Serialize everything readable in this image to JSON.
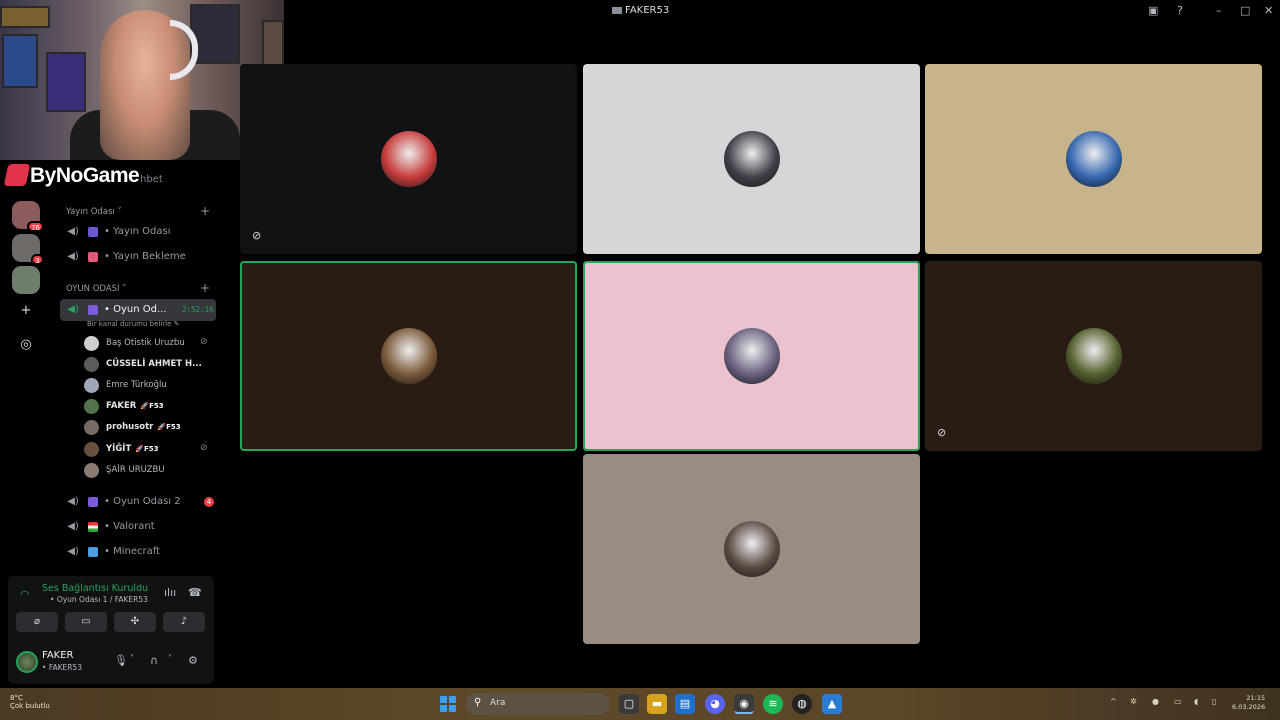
{
  "window": {
    "title": "FAKER53"
  },
  "overlay": {
    "brand": "ByNoGame",
    "brand_tail": "hbet"
  },
  "servers": [
    {
      "badge": "76",
      "color": "#8c5b5b"
    },
    {
      "badge": "3",
      "color": "#6d6a68"
    },
    {
      "badge": "",
      "color": "#6f7d6c"
    }
  ],
  "categories": {
    "yayin": "Yayın Odası",
    "oyun": "OYUN ODASI"
  },
  "channels": {
    "yayin_odasi": "Yayın Odası",
    "yayin_bekleme": "Yayın Bekleme",
    "oyun_odasi": "Oyun Od...",
    "oyun_timer": "2:52:16",
    "oyun_status": "Bir kanal durumu belirle",
    "oyun_odasi_2": "Oyun Odası 2",
    "oyun_odasi_2_badge": "4",
    "valorant": "Valorant",
    "minecraft": "Minecraft"
  },
  "members": [
    {
      "name": "Baş Otistik Uruzbu",
      "tag": "",
      "color": "#cfcfcf",
      "muted": true,
      "bold": false
    },
    {
      "name": "CÜSSELİ AHMET H...",
      "tag": "",
      "color": "#5b5b5b",
      "muted": false,
      "bold": true
    },
    {
      "name": "Emre Türkoğlu",
      "tag": "",
      "color": "#a0a8b8",
      "muted": false,
      "bold": false
    },
    {
      "name": "FAKER",
      "tag": "F53",
      "color": "#52744a",
      "muted": false,
      "bold": true
    },
    {
      "name": "prohusotr",
      "tag": "F53",
      "color": "#7a6a66",
      "muted": false,
      "bold": true
    },
    {
      "name": "YİĞİT",
      "tag": "F53",
      "color": "#6a4f3f",
      "muted": true,
      "bold": true
    },
    {
      "name": "ŞAİR URUZBU",
      "tag": "",
      "color": "#8a7a70",
      "muted": false,
      "bold": false
    }
  ],
  "voice": {
    "status": "Ses Bağlantısı Kuruldu",
    "location": "Oyun Odası 1 / FAKER53"
  },
  "user": {
    "name": "FAKER",
    "sub": "FAKER53"
  },
  "tiles": [
    {
      "bg": "#111214",
      "avatar": "#c73c3c",
      "muted": true,
      "speaking": false
    },
    {
      "bg": "#d5d6d8",
      "avatar": "#40404a",
      "muted": false,
      "speaking": false
    },
    {
      "bg": "#c8b48a",
      "avatar": "#3567b0",
      "muted": false,
      "speaking": false
    },
    {
      "bg": "#2a1c14",
      "avatar": "#7a5a3a",
      "muted": false,
      "speaking": true
    },
    {
      "bg": "#ebc2cd",
      "avatar": "#6a6080",
      "muted": false,
      "speaking": true
    },
    {
      "bg": "#2a1c14",
      "avatar": "#54602f",
      "muted": true,
      "speaking": false
    },
    {
      "bg": "#9a8c80",
      "avatar": "#5a4a44",
      "muted": false,
      "speaking": false
    }
  ],
  "taskbar": {
    "weather_line1": "8°C",
    "weather_line2": "Çok bulutlu",
    "search_placeholder": "Ara",
    "time": "21:15",
    "date": "6.03.2026"
  }
}
